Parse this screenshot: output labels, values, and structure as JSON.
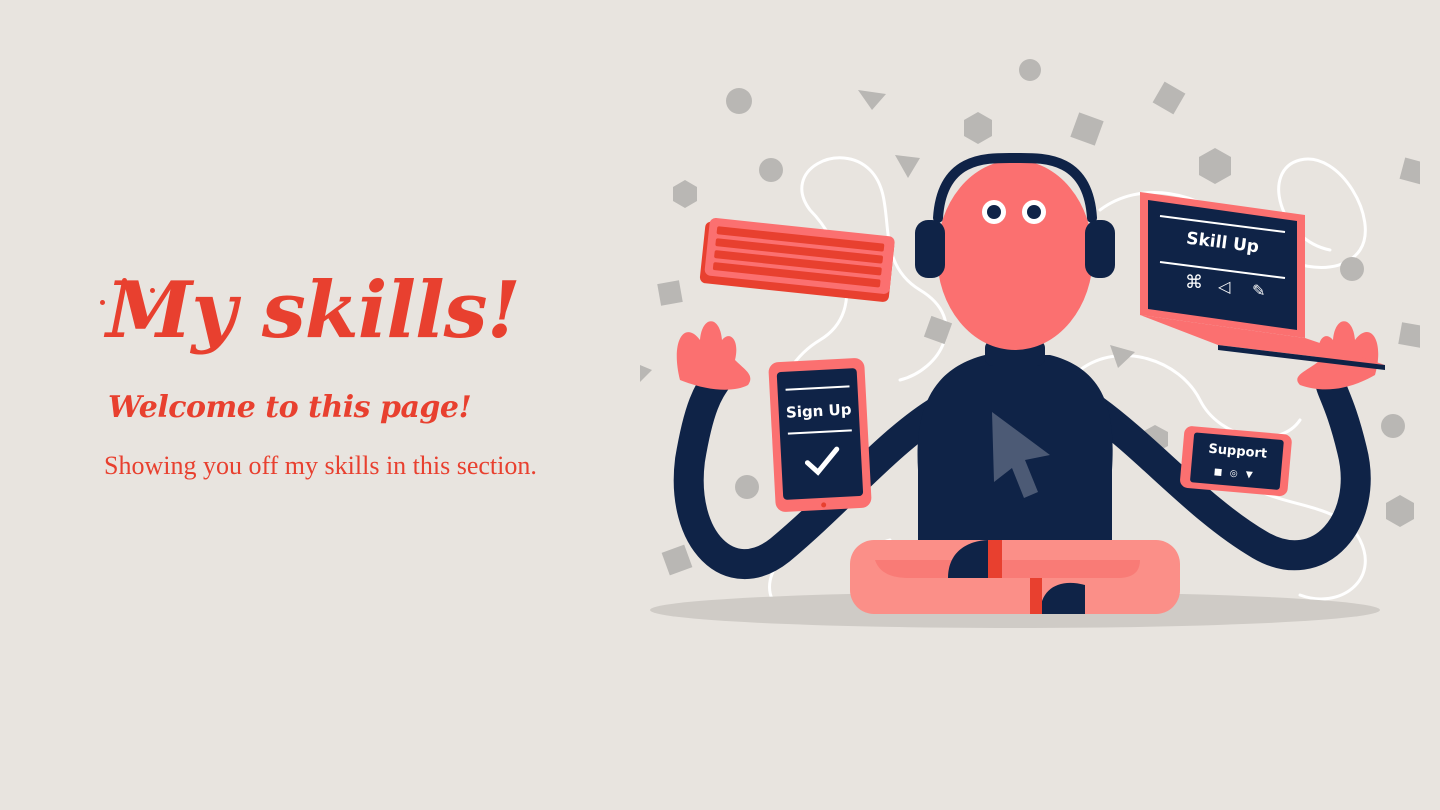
{
  "hero": {
    "title": "My skills!",
    "subtitle": "Welcome to this page!",
    "description": "Showing you off my skills in this section."
  },
  "illustration": {
    "laptop_label": "Skill Up",
    "tablet_label": "Sign Up",
    "phone_label": "Support"
  },
  "colors": {
    "background": "#e8e4df",
    "accent": "#e8402f",
    "figure_skin": "#fb7070",
    "figure_body": "#0f2347",
    "icon_gray": "#b9b7b4"
  }
}
